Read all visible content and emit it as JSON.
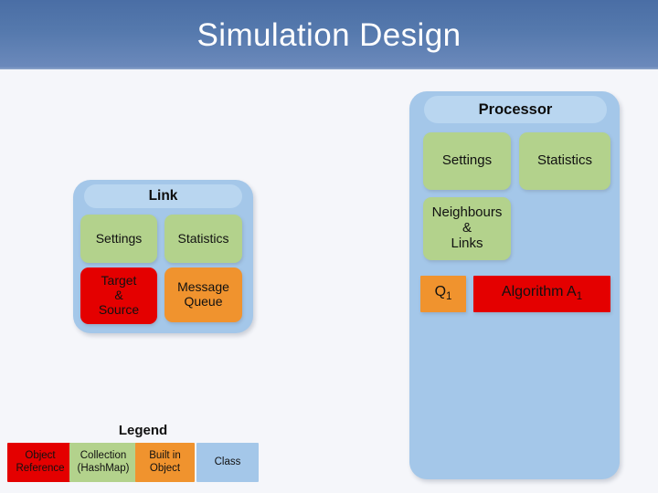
{
  "slide": {
    "title": "Simulation Design",
    "background_color": "#f5f6fa",
    "banner_color_top": "#4a6ea5",
    "banner_color_bottom": "#6b89bb",
    "title_color": "#ffffff"
  },
  "diagram": {
    "processor": {
      "name": "Processor",
      "type": "Class",
      "color": "#a4c7e9",
      "header_color": "#b9d6f0",
      "members": [
        {
          "label": "Settings",
          "kind": "Collection (HashMap)",
          "color": "#b3d28c"
        },
        {
          "label": "Statistics",
          "kind": "Collection (HashMap)",
          "color": "#b3d28c"
        },
        {
          "label_line1": "Neighbours",
          "label_line2": "&",
          "label_line3": "Links",
          "kind": "Collection (HashMap)",
          "color": "#b3d28c"
        },
        {
          "label": "Q",
          "subscript": "1",
          "kind": "Built in Object",
          "color": "#f0932e"
        },
        {
          "label": "Algorithm A",
          "subscript": "1",
          "kind": "Object Reference",
          "color": "#e40000"
        }
      ]
    },
    "link": {
      "name": "Link",
      "type": "Class",
      "color": "#a4c7e9",
      "header_color": "#b9d6f0",
      "members": [
        {
          "label": "Settings",
          "kind": "Collection (HashMap)",
          "color": "#b3d28c"
        },
        {
          "label": "Statistics",
          "kind": "Collection (HashMap)",
          "color": "#b3d28c"
        },
        {
          "label_line1": "Target",
          "label_line2": "&",
          "label_line3": "Source",
          "kind": "Object Reference",
          "color": "#e40000"
        },
        {
          "label_line1": "Message",
          "label_line2": "Queue",
          "kind": "Built in Object",
          "color": "#f0932e"
        }
      ]
    }
  },
  "legend": {
    "title": "Legend",
    "items": [
      {
        "line1": "Object",
        "line2": "Reference",
        "color": "#e40000"
      },
      {
        "line1": "Collection",
        "line2": "(HashMap)",
        "color": "#b3d28c"
      },
      {
        "line1": "Built in",
        "line2": "Object",
        "color": "#f0932e"
      },
      {
        "line1": "Class",
        "line2": "",
        "color": "#a4c7e9"
      }
    ]
  }
}
